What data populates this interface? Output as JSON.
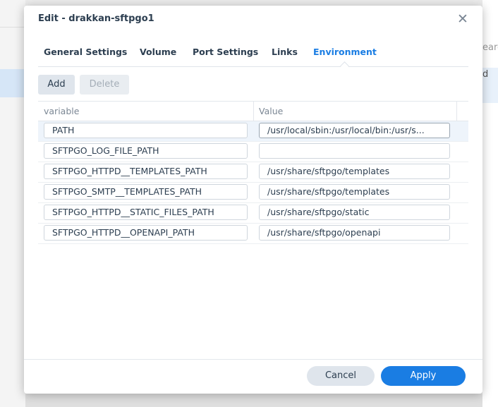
{
  "background": {
    "right_search_fragment": "earc",
    "right_text_fragment": "d"
  },
  "dialog": {
    "title": "Edit - drakkan-sftpgo1",
    "close_icon": "close-icon"
  },
  "tabs": [
    {
      "label": "General Settings",
      "active": false
    },
    {
      "label": "Volume",
      "active": false
    },
    {
      "label": "Port Settings",
      "active": false
    },
    {
      "label": "Links",
      "active": false
    },
    {
      "label": "Environment",
      "active": true
    }
  ],
  "toolbar": {
    "add_label": "Add",
    "delete_label": "Delete"
  },
  "table": {
    "columns": [
      "variable",
      "Value"
    ],
    "rows": [
      {
        "variable": "PATH",
        "value": "/usr/local/sbin:/usr/local/bin:/usr/s..."
      },
      {
        "variable": "SFTPGO_LOG_FILE_PATH",
        "value": ""
      },
      {
        "variable": "SFTPGO_HTTPD__TEMPLATES_PATH",
        "value": "/usr/share/sftpgo/templates"
      },
      {
        "variable": "SFTPGO_SMTP__TEMPLATES_PATH",
        "value": "/usr/share/sftpgo/templates"
      },
      {
        "variable": "SFTPGO_HTTPD__STATIC_FILES_PATH",
        "value": "/usr/share/sftpgo/static"
      },
      {
        "variable": "SFTPGO_HTTPD__OPENAPI_PATH",
        "value": "/usr/share/sftpgo/openapi"
      }
    ]
  },
  "footer": {
    "cancel_label": "Cancel",
    "apply_label": "Apply"
  },
  "colors": {
    "accent": "#1a7de3",
    "text": "#2c3e50",
    "selected_row": "#eef4fb"
  }
}
